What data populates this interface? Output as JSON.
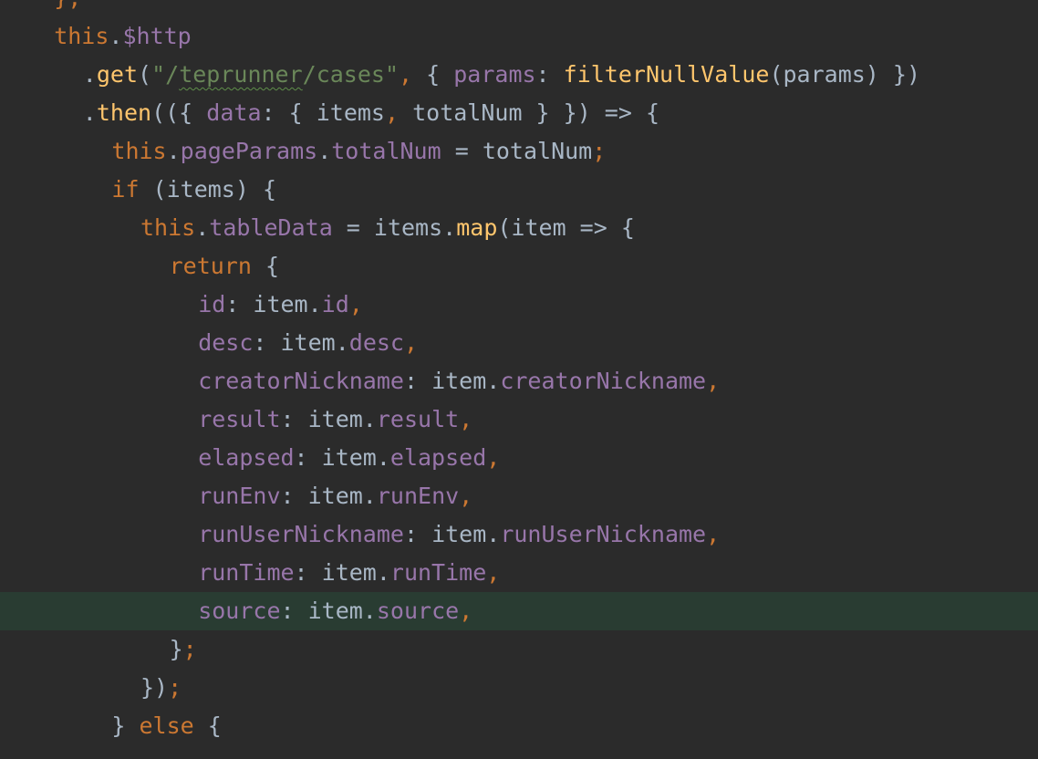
{
  "editor": {
    "language": "javascript",
    "highlighted_line": 16,
    "colors": {
      "background": "#2b2b2b",
      "current_line": "#293c32",
      "keyword": "#cc7832",
      "property": "#9876aa",
      "string": "#6a8759",
      "function": "#ffc66d",
      "identifier": "#a9b7c6"
    },
    "lines": [
      {
        "indent": 2,
        "tokens": [
          {
            "t": "};",
            "c": "sep"
          }
        ]
      },
      {
        "indent": 2,
        "tokens": [
          {
            "t": "this",
            "c": "kw"
          },
          {
            "t": ".",
            "c": "pun"
          },
          {
            "t": "$http",
            "c": "prop"
          }
        ]
      },
      {
        "indent": 3,
        "tokens": [
          {
            "t": ".",
            "c": "pun"
          },
          {
            "t": "get",
            "c": "fn"
          },
          {
            "t": "(",
            "c": "pun"
          },
          {
            "t": "\"/",
            "c": "str"
          },
          {
            "t": "teprunner",
            "c": "str",
            "typo": true
          },
          {
            "t": "/cases\"",
            "c": "str"
          },
          {
            "t": ", ",
            "c": "sep"
          },
          {
            "t": "{ ",
            "c": "pun"
          },
          {
            "t": "params",
            "c": "prop"
          },
          {
            "t": ": ",
            "c": "pun"
          },
          {
            "t": "filterNullValue",
            "c": "fn"
          },
          {
            "t": "(params) })",
            "c": "pun"
          }
        ]
      },
      {
        "indent": 3,
        "tokens": [
          {
            "t": ".",
            "c": "pun"
          },
          {
            "t": "then",
            "c": "fn"
          },
          {
            "t": "(({ ",
            "c": "pun"
          },
          {
            "t": "data",
            "c": "prop"
          },
          {
            "t": ": { items",
            "c": "pun"
          },
          {
            "t": ", ",
            "c": "sep"
          },
          {
            "t": "totalNum } }) => {",
            "c": "pun"
          }
        ]
      },
      {
        "indent": 4,
        "tokens": [
          {
            "t": "this",
            "c": "kw"
          },
          {
            "t": ".",
            "c": "pun"
          },
          {
            "t": "pageParams",
            "c": "prop"
          },
          {
            "t": ".",
            "c": "pun"
          },
          {
            "t": "totalNum",
            "c": "prop"
          },
          {
            "t": " = totalNum",
            "c": "pun"
          },
          {
            "t": ";",
            "c": "sep"
          }
        ]
      },
      {
        "indent": 4,
        "tokens": [
          {
            "t": "if ",
            "c": "kw"
          },
          {
            "t": "(items) {",
            "c": "pun"
          }
        ]
      },
      {
        "indent": 5,
        "tokens": [
          {
            "t": "this",
            "c": "kw"
          },
          {
            "t": ".",
            "c": "pun"
          },
          {
            "t": "tableData",
            "c": "prop"
          },
          {
            "t": " = items.",
            "c": "pun"
          },
          {
            "t": "map",
            "c": "fn"
          },
          {
            "t": "(item => {",
            "c": "pun"
          }
        ]
      },
      {
        "indent": 6,
        "tokens": [
          {
            "t": "return ",
            "c": "kw"
          },
          {
            "t": "{",
            "c": "pun"
          }
        ]
      },
      {
        "indent": 7,
        "tokens": [
          {
            "t": "id",
            "c": "prop"
          },
          {
            "t": ": item.",
            "c": "pun"
          },
          {
            "t": "id",
            "c": "prop"
          },
          {
            "t": ",",
            "c": "sep"
          }
        ]
      },
      {
        "indent": 7,
        "tokens": [
          {
            "t": "desc",
            "c": "prop"
          },
          {
            "t": ": item.",
            "c": "pun"
          },
          {
            "t": "desc",
            "c": "prop"
          },
          {
            "t": ",",
            "c": "sep"
          }
        ]
      },
      {
        "indent": 7,
        "tokens": [
          {
            "t": "creatorNickname",
            "c": "prop"
          },
          {
            "t": ": item.",
            "c": "pun"
          },
          {
            "t": "creatorNickname",
            "c": "prop"
          },
          {
            "t": ",",
            "c": "sep"
          }
        ]
      },
      {
        "indent": 7,
        "tokens": [
          {
            "t": "result",
            "c": "prop"
          },
          {
            "t": ": item.",
            "c": "pun"
          },
          {
            "t": "result",
            "c": "prop"
          },
          {
            "t": ",",
            "c": "sep"
          }
        ]
      },
      {
        "indent": 7,
        "tokens": [
          {
            "t": "elapsed",
            "c": "prop"
          },
          {
            "t": ": item.",
            "c": "pun"
          },
          {
            "t": "elapsed",
            "c": "prop"
          },
          {
            "t": ",",
            "c": "sep"
          }
        ]
      },
      {
        "indent": 7,
        "tokens": [
          {
            "t": "runEnv",
            "c": "prop"
          },
          {
            "t": ": item.",
            "c": "pun"
          },
          {
            "t": "runEnv",
            "c": "prop"
          },
          {
            "t": ",",
            "c": "sep"
          }
        ]
      },
      {
        "indent": 7,
        "tokens": [
          {
            "t": "runUserNickname",
            "c": "prop"
          },
          {
            "t": ": item.",
            "c": "pun"
          },
          {
            "t": "runUserNickname",
            "c": "prop"
          },
          {
            "t": ",",
            "c": "sep"
          }
        ]
      },
      {
        "indent": 7,
        "tokens": [
          {
            "t": "runTime",
            "c": "prop"
          },
          {
            "t": ": item.",
            "c": "pun"
          },
          {
            "t": "runTime",
            "c": "prop"
          },
          {
            "t": ",",
            "c": "sep"
          }
        ]
      },
      {
        "indent": 7,
        "tokens": [
          {
            "t": "source",
            "c": "prop"
          },
          {
            "t": ": item.",
            "c": "pun"
          },
          {
            "t": "source",
            "c": "prop"
          },
          {
            "t": ",",
            "c": "sep"
          }
        ]
      },
      {
        "indent": 6,
        "tokens": [
          {
            "t": "}",
            "c": "pun"
          },
          {
            "t": ";",
            "c": "sep"
          }
        ]
      },
      {
        "indent": 5,
        "tokens": [
          {
            "t": "})",
            "c": "pun"
          },
          {
            "t": ";",
            "c": "sep"
          }
        ]
      },
      {
        "indent": 4,
        "tokens": [
          {
            "t": "} ",
            "c": "pun"
          },
          {
            "t": "else ",
            "c": "kw"
          },
          {
            "t": "{",
            "c": "pun"
          }
        ]
      }
    ]
  }
}
